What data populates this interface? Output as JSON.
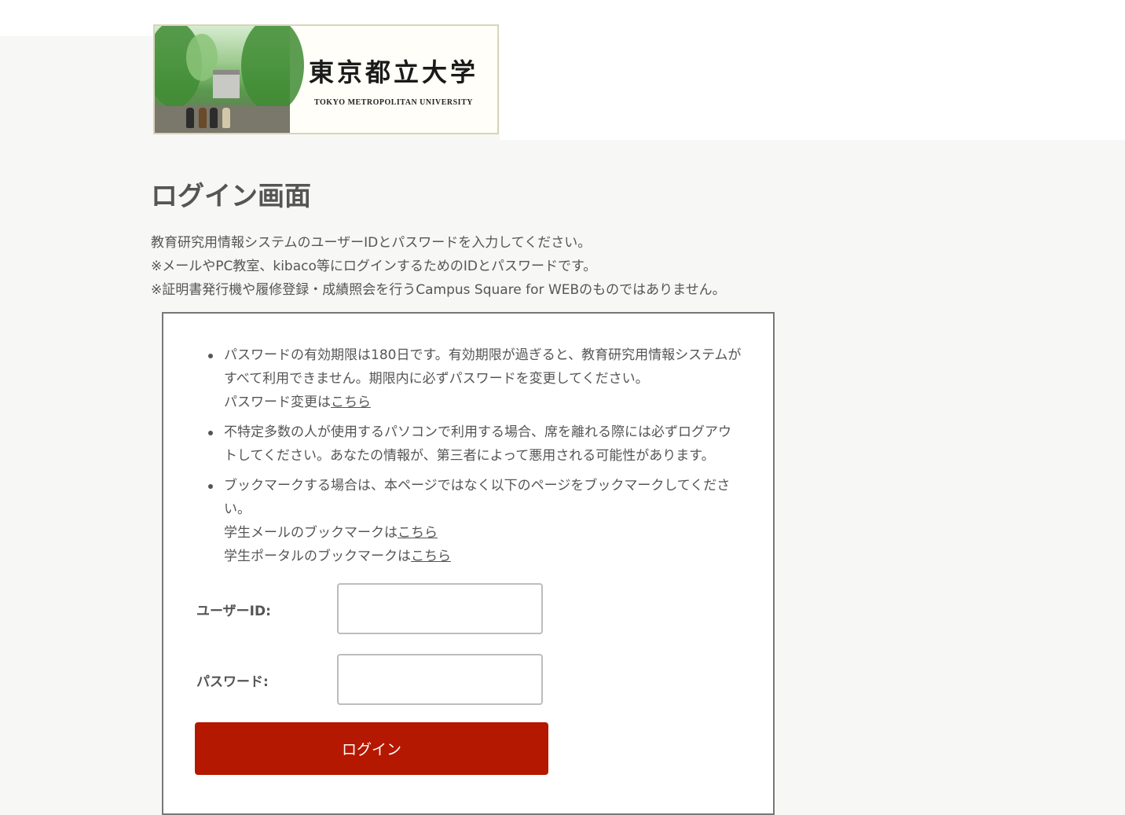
{
  "logo": {
    "title_jp": "東京都立大学",
    "title_en": "TOKYO METROPOLITAN UNIVERSITY"
  },
  "page": {
    "title": "ログイン画面",
    "intro": [
      "教育研究用情報システムのユーザーIDとパスワードを入力してください。",
      "※メールやPC教室、kibaco等にログインするためのIDとパスワードです。",
      "※証明書発行機や履修登録・成績照会を行うCampus Square for WEBのものではありません。"
    ]
  },
  "notices": {
    "password_expiry": "パスワードの有効期限は180日です。有効期限が過ぎると、教育研究用情報システムがすべて利用できません。期限内に必ずパスワードを変更してください。",
    "password_change_prefix": "パスワード変更は",
    "logout_warning": "不特定多数の人が使用するパソコンで利用する場合、席を離れる際には必ずログアウトしてください。あなたの情報が、第三者によって悪用される可能性があります。",
    "bookmark_note": "ブックマークする場合は、本ページではなく以下のページをブックマークしてください。",
    "student_mail_prefix": "学生メールのブックマークは",
    "student_portal_prefix": "学生ポータルのブックマークは",
    "link_text": "こちら"
  },
  "form": {
    "user_id_label": "ユーザーID:",
    "user_id_value": "",
    "password_label": "パスワード:",
    "password_value": "",
    "login_label": "ログイン"
  }
}
